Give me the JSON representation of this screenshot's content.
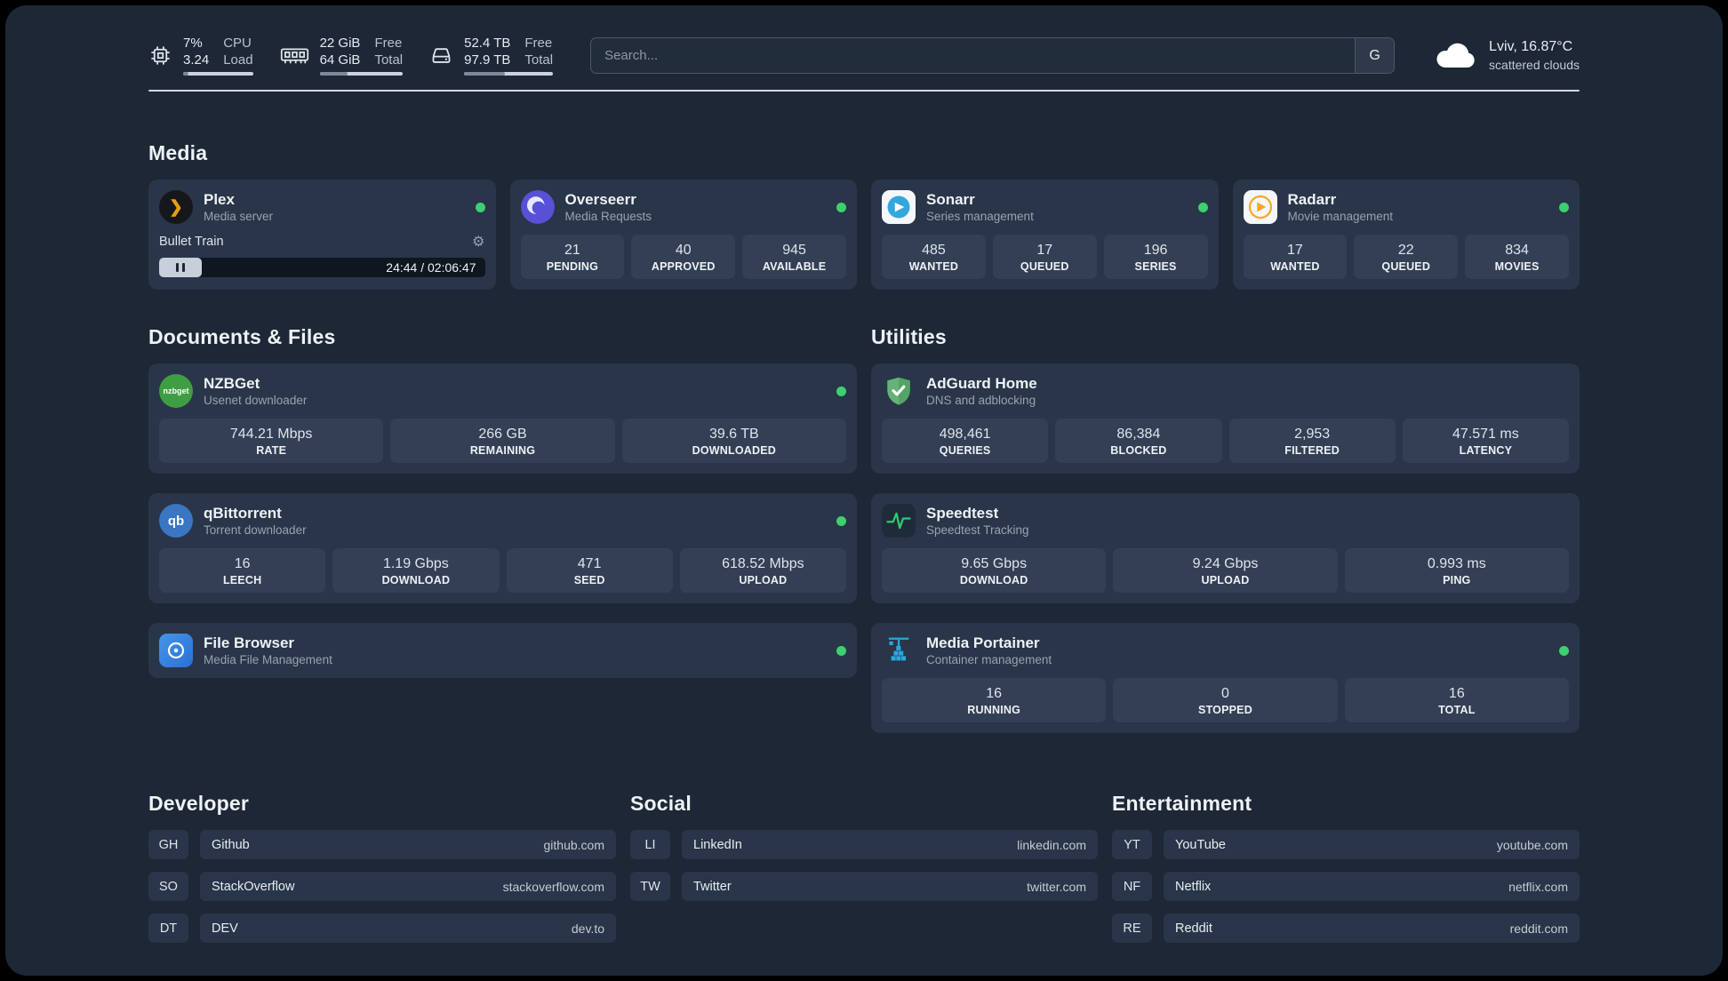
{
  "topbar": {
    "cpu": {
      "value_top": "7%",
      "value_bottom": "3.24",
      "label_top": "CPU",
      "label_bottom": "Load"
    },
    "ram": {
      "value_top": "22 GiB",
      "value_bottom": "64 GiB",
      "label_top": "Free",
      "label_bottom": "Total"
    },
    "disk": {
      "value_top": "52.4 TB",
      "value_bottom": "97.9 TB",
      "label_top": "Free",
      "label_bottom": "Total"
    },
    "search": {
      "placeholder": "Search...",
      "engine_label": "G"
    },
    "weather": {
      "location": "Lviv, 16.87°C",
      "condition": "scattered clouds"
    }
  },
  "sections": {
    "media": "Media",
    "documents": "Documents & Files",
    "utilities": "Utilities",
    "developer": "Developer",
    "social": "Social",
    "entertainment": "Entertainment"
  },
  "icons": {
    "plex_glyph": "❯",
    "gear": "⚙"
  },
  "apps": {
    "plex": {
      "name": "Plex",
      "subtitle": "Media server",
      "now_playing": "Bullet Train",
      "time": "24:44 / 02:06:47"
    },
    "overseerr": {
      "name": "Overseerr",
      "subtitle": "Media Requests",
      "stats": [
        {
          "value": "21",
          "label": "PENDING"
        },
        {
          "value": "40",
          "label": "APPROVED"
        },
        {
          "value": "945",
          "label": "AVAILABLE"
        }
      ]
    },
    "sonarr": {
      "name": "Sonarr",
      "subtitle": "Series management",
      "stats": [
        {
          "value": "485",
          "label": "WANTED"
        },
        {
          "value": "17",
          "label": "QUEUED"
        },
        {
          "value": "196",
          "label": "SERIES"
        }
      ]
    },
    "radarr": {
      "name": "Radarr",
      "subtitle": "Movie management",
      "stats": [
        {
          "value": "17",
          "label": "WANTED"
        },
        {
          "value": "22",
          "label": "QUEUED"
        },
        {
          "value": "834",
          "label": "MOVIES"
        }
      ]
    },
    "nzbget": {
      "name": "NZBGet",
      "subtitle": "Usenet downloader",
      "icon_text": "nzbget",
      "stats": [
        {
          "value": "744.21 Mbps",
          "label": "RATE"
        },
        {
          "value": "266 GB",
          "label": "REMAINING"
        },
        {
          "value": "39.6 TB",
          "label": "DOWNLOADED"
        }
      ]
    },
    "qbittorrent": {
      "name": "qBittorrent",
      "subtitle": "Torrent downloader",
      "icon_text": "qb",
      "stats": [
        {
          "value": "16",
          "label": "LEECH"
        },
        {
          "value": "1.19 Gbps",
          "label": "DOWNLOAD"
        },
        {
          "value": "471",
          "label": "SEED"
        },
        {
          "value": "618.52 Mbps",
          "label": "UPLOAD"
        }
      ]
    },
    "filebrowser": {
      "name": "File Browser",
      "subtitle": "Media File Management"
    },
    "adguard": {
      "name": "AdGuard Home",
      "subtitle": "DNS and adblocking",
      "stats": [
        {
          "value": "498,461",
          "label": "QUERIES"
        },
        {
          "value": "86,384",
          "label": "BLOCKED"
        },
        {
          "value": "2,953",
          "label": "FILTERED"
        },
        {
          "value": "47.571 ms",
          "label": "LATENCY"
        }
      ]
    },
    "speedtest": {
      "name": "Speedtest",
      "subtitle": "Speedtest Tracking",
      "stats": [
        {
          "value": "9.65 Gbps",
          "label": "DOWNLOAD"
        },
        {
          "value": "9.24 Gbps",
          "label": "UPLOAD"
        },
        {
          "value": "0.993 ms",
          "label": "PING"
        }
      ]
    },
    "portainer": {
      "name": "Media Portainer",
      "subtitle": "Container management",
      "stats": [
        {
          "value": "16",
          "label": "RUNNING"
        },
        {
          "value": "0",
          "label": "STOPPED"
        },
        {
          "value": "16",
          "label": "TOTAL"
        }
      ]
    }
  },
  "bookmarks": {
    "developer": [
      {
        "abbr": "GH",
        "name": "Github",
        "url": "github.com"
      },
      {
        "abbr": "SO",
        "name": "StackOverflow",
        "url": "stackoverflow.com"
      },
      {
        "abbr": "DT",
        "name": "DEV",
        "url": "dev.to"
      }
    ],
    "social": [
      {
        "abbr": "LI",
        "name": "LinkedIn",
        "url": "linkedin.com"
      },
      {
        "abbr": "TW",
        "name": "Twitter",
        "url": "twitter.com"
      }
    ],
    "entertainment": [
      {
        "abbr": "YT",
        "name": "YouTube",
        "url": "youtube.com"
      },
      {
        "abbr": "NF",
        "name": "Netflix",
        "url": "netflix.com"
      },
      {
        "abbr": "RE",
        "name": "Reddit",
        "url": "reddit.com"
      }
    ]
  }
}
